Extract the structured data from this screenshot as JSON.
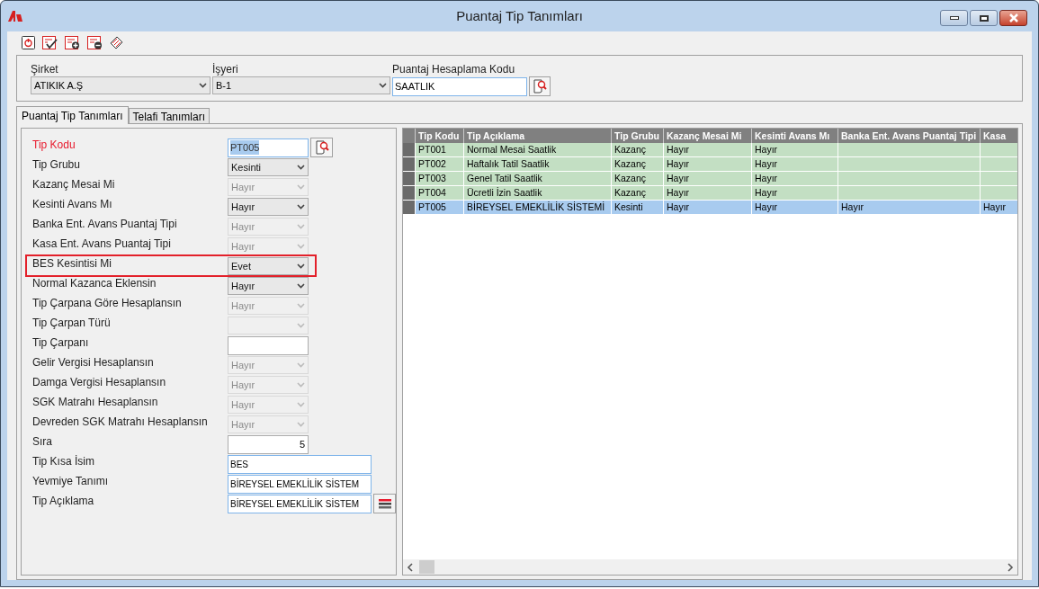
{
  "window": {
    "title": "Puantaj Tip Tanımları"
  },
  "filters": [
    {
      "label": "Şirket",
      "value": "ATIKIK A.Ş",
      "kind": "select"
    },
    {
      "label": "İşyeri",
      "value": "B-1",
      "kind": "select"
    },
    {
      "label": "Puantaj Hesaplama Kodu",
      "value": "SAATLIK",
      "kind": "lookup"
    }
  ],
  "tabs": [
    {
      "label": "Puantaj Tip Tanımları",
      "selected": true
    },
    {
      "label": "Telafi Tanımları",
      "selected": false
    }
  ],
  "form": [
    {
      "label": "Tip Kodu",
      "kind": "lookup",
      "value": "PT005",
      "required": true
    },
    {
      "label": "Tip Grubu",
      "kind": "select",
      "value": "Kesinti",
      "required": false,
      "disabled": false
    },
    {
      "label": "Kazanç Mesai Mi",
      "kind": "select",
      "value": "Hayır",
      "required": false,
      "disabled": true
    },
    {
      "label": "Kesinti Avans Mı",
      "kind": "select",
      "value": "Hayır",
      "required": false,
      "disabled": false
    },
    {
      "label": "Banka Ent. Avans Puantaj Tipi",
      "kind": "select",
      "value": "Hayır",
      "required": false,
      "disabled": true
    },
    {
      "label": "Kasa Ent. Avans Puantaj Tipi",
      "kind": "select",
      "value": "Hayır",
      "required": false,
      "disabled": true
    },
    {
      "label": "BES Kesintisi Mi",
      "kind": "select",
      "value": "Evet",
      "required": false,
      "disabled": false,
      "outlined": true
    },
    {
      "label": "Normal Kazanca Eklensin",
      "kind": "select",
      "value": "Hayır",
      "required": false,
      "disabled": false
    },
    {
      "label": "Tip Çarpana Göre Hesaplansın",
      "kind": "select",
      "value": "Hayır",
      "required": false,
      "disabled": true
    },
    {
      "label": "Tip Çarpan Türü",
      "kind": "select",
      "required": false,
      "disabled": true
    },
    {
      "label": "Tip Çarpanı",
      "kind": "number",
      "required": false
    },
    {
      "label": "Gelir Vergisi Hesaplansın",
      "kind": "select",
      "value": "Hayır",
      "required": false,
      "disabled": true
    },
    {
      "label": "Damga Vergisi Hesaplansın",
      "kind": "select",
      "value": "Hayır",
      "required": false,
      "disabled": true
    },
    {
      "label": "SGK Matrahı Hesaplansın",
      "kind": "select",
      "value": "Hayır",
      "required": false,
      "disabled": true
    },
    {
      "label": "Devreden SGK Matrahı Hesaplansın",
      "kind": "select",
      "value": "Hayır",
      "required": false,
      "disabled": true
    },
    {
      "label": "Sıra",
      "kind": "number",
      "value": "5",
      "required": false
    },
    {
      "label": "Tip Kısa İsim",
      "kind": "text",
      "value": "BES",
      "required": false
    },
    {
      "label": "Yevmiye Tanımı",
      "kind": "text",
      "value": "BİREYSEL EMEKLİLİK SİSTEM",
      "required": false
    },
    {
      "label": "Tip Açıklama",
      "kind": "memo",
      "value": "BİREYSEL EMEKLİLİK SİSTEM",
      "required": false
    }
  ],
  "table": {
    "columns": [
      "Tip Kodu",
      "Tip Açıklama",
      "Tip Grubu",
      "Kazanç Mesai Mi",
      "Kesinti Avans Mı",
      "Banka Ent. Avans Puantaj Tipi",
      "Kasa"
    ],
    "rows": [
      {
        "selected": false,
        "cells": [
          "PT001",
          "Normal Mesai Saatlik",
          "Kazanç",
          "Hayır",
          "Hayır",
          null,
          null
        ]
      },
      {
        "selected": false,
        "cells": [
          "PT002",
          "Haftalık Tatil Saatlik",
          "Kazanç",
          "Hayır",
          "Hayır",
          null,
          null
        ]
      },
      {
        "selected": false,
        "cells": [
          "PT003",
          "Genel Tatil Saatlik",
          "Kazanç",
          "Hayır",
          "Hayır",
          null,
          null
        ]
      },
      {
        "selected": false,
        "cells": [
          "PT004",
          "Ücretli İzin Saatlik",
          "Kazanç",
          "Hayır",
          "Hayır",
          null,
          null
        ]
      },
      {
        "selected": true,
        "cells": [
          "PT005",
          "BİREYSEL EMEKLİLİK SİSTEMİ",
          "Kesinti",
          "Hayır",
          "Hayır",
          "Hayır",
          "Hayır"
        ]
      }
    ]
  }
}
